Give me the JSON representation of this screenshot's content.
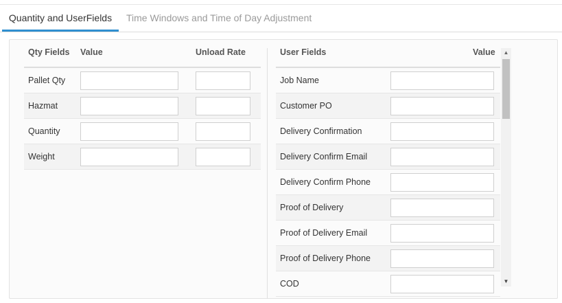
{
  "tabs": [
    {
      "label": "Quantity and UserFields",
      "active": true
    },
    {
      "label": "Time Windows and Time of Day Adjustment",
      "active": false
    }
  ],
  "qty_table": {
    "headers": {
      "field": "Qty Fields",
      "value": "Value",
      "rate": "Unload Rate"
    },
    "rows": [
      {
        "label": "Pallet Qty",
        "value": "",
        "rate": ""
      },
      {
        "label": "Hazmat",
        "value": "",
        "rate": ""
      },
      {
        "label": "Quantity",
        "value": "",
        "rate": ""
      },
      {
        "label": "Weight",
        "value": "",
        "rate": ""
      }
    ]
  },
  "user_fields": {
    "headers": {
      "field": "User Fields",
      "value": "Value"
    },
    "rows": [
      {
        "label": "Job Name",
        "value": ""
      },
      {
        "label": "Customer PO",
        "value": ""
      },
      {
        "label": "Delivery Confirmation",
        "value": ""
      },
      {
        "label": "Delivery Confirm Email",
        "value": ""
      },
      {
        "label": "Delivery Confirm Phone",
        "value": ""
      },
      {
        "label": "Proof of Delivery",
        "value": ""
      },
      {
        "label": "Proof of Delivery Email",
        "value": ""
      },
      {
        "label": "Proof of Delivery Phone",
        "value": ""
      },
      {
        "label": "COD",
        "value": ""
      }
    ]
  },
  "scrollbar": {
    "up_arrow": "▲",
    "down_arrow": "▼"
  },
  "colors": {
    "accent": "#2f8fd0",
    "row_shade": "#f3f3f3"
  }
}
